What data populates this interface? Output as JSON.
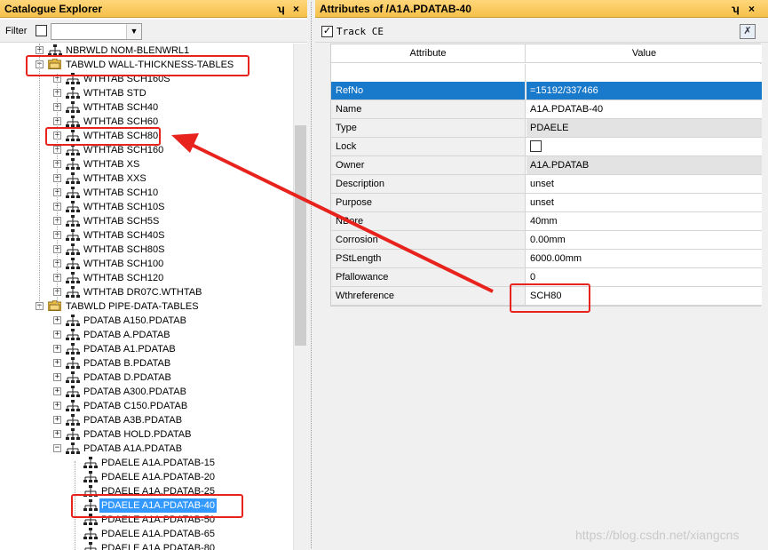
{
  "left_panel": {
    "title": "Catalogue Explorer",
    "pin": "ʮ",
    "close": "×",
    "filter_label": "Filter",
    "filter_value": ""
  },
  "tree": {
    "items": [
      {
        "label": "NBRWLD NOM-BLENWRL1",
        "exp": "+",
        "icon": "tree-icon"
      },
      {
        "label": "TABWLD WALL-THICKNESS-TABLES",
        "exp": "−",
        "icon": "folder-icon"
      },
      {
        "label": "WTHTAB SCH160S",
        "exp": "+",
        "icon": "tree-icon"
      },
      {
        "label": "WTHTAB STD",
        "exp": "+",
        "icon": "tree-icon"
      },
      {
        "label": "WTHTAB SCH40",
        "exp": "+",
        "icon": "tree-icon"
      },
      {
        "label": "WTHTAB SCH60",
        "exp": "+",
        "icon": "tree-icon"
      },
      {
        "label": "WTHTAB SCH80",
        "exp": "+",
        "icon": "tree-icon"
      },
      {
        "label": "WTHTAB SCH160",
        "exp": "+",
        "icon": "tree-icon"
      },
      {
        "label": "WTHTAB XS",
        "exp": "+",
        "icon": "tree-icon"
      },
      {
        "label": "WTHTAB XXS",
        "exp": "+",
        "icon": "tree-icon"
      },
      {
        "label": "WTHTAB SCH10",
        "exp": "+",
        "icon": "tree-icon"
      },
      {
        "label": "WTHTAB SCH10S",
        "exp": "+",
        "icon": "tree-icon"
      },
      {
        "label": "WTHTAB SCH5S",
        "exp": "+",
        "icon": "tree-icon"
      },
      {
        "label": "WTHTAB SCH40S",
        "exp": "+",
        "icon": "tree-icon"
      },
      {
        "label": "WTHTAB SCH80S",
        "exp": "+",
        "icon": "tree-icon"
      },
      {
        "label": "WTHTAB SCH100",
        "exp": "+",
        "icon": "tree-icon"
      },
      {
        "label": "WTHTAB SCH120",
        "exp": "+",
        "icon": "tree-icon"
      },
      {
        "label": "WTHTAB DR07C.WTHTAB",
        "exp": "+",
        "icon": "tree-icon"
      },
      {
        "label": "TABWLD PIPE-DATA-TABLES",
        "exp": "−",
        "icon": "folder-icon"
      },
      {
        "label": "PDATAB A150.PDATAB",
        "exp": "+",
        "icon": "tree-icon"
      },
      {
        "label": "PDATAB A.PDATAB",
        "exp": "+",
        "icon": "tree-icon"
      },
      {
        "label": "PDATAB A1.PDATAB",
        "exp": "+",
        "icon": "tree-icon"
      },
      {
        "label": "PDATAB B.PDATAB",
        "exp": "+",
        "icon": "tree-icon"
      },
      {
        "label": "PDATAB D.PDATAB",
        "exp": "+",
        "icon": "tree-icon"
      },
      {
        "label": "PDATAB A300.PDATAB",
        "exp": "+",
        "icon": "tree-icon"
      },
      {
        "label": "PDATAB C150.PDATAB",
        "exp": "+",
        "icon": "tree-icon"
      },
      {
        "label": "PDATAB A3B.PDATAB",
        "exp": "+",
        "icon": "tree-icon"
      },
      {
        "label": "PDATAB HOLD.PDATAB",
        "exp": "+",
        "icon": "tree-icon"
      },
      {
        "label": "PDATAB A1A.PDATAB",
        "exp": "−",
        "icon": "tree-icon"
      },
      {
        "label": "PDAELE A1A.PDATAB-15",
        "exp": "",
        "icon": "tree-icon"
      },
      {
        "label": "PDAELE A1A.PDATAB-20",
        "exp": "",
        "icon": "tree-icon"
      },
      {
        "label": "PDAELE A1A.PDATAB-25",
        "exp": "",
        "icon": "tree-icon"
      },
      {
        "label": "PDAELE A1A.PDATAB-40",
        "exp": "",
        "icon": "tree-icon",
        "selected": true
      },
      {
        "label": "PDAELE A1A.PDATAB-50",
        "exp": "",
        "icon": "tree-icon"
      },
      {
        "label": "PDAELE A1A.PDATAB-65",
        "exp": "",
        "icon": "tree-icon"
      },
      {
        "label": "PDAELE A1A.PDATAB-80",
        "exp": "",
        "icon": "tree-icon"
      }
    ]
  },
  "right_panel": {
    "title": "Attributes of /A1A.PDATAB-40",
    "pin": "ʮ",
    "close": "×",
    "track_label": "Track CE",
    "track_checked": "✓",
    "clear_icon": "✗"
  },
  "grid": {
    "headers": {
      "attribute": "Attribute",
      "value": "Value"
    },
    "rows": [
      {
        "attribute": "RefNo",
        "value": "=15192/337466",
        "selected": true
      },
      {
        "attribute": "Name",
        "value": "A1A.PDATAB-40"
      },
      {
        "attribute": "Type",
        "value": "PDAELE",
        "readonly": true
      },
      {
        "attribute": "Lock",
        "value": "",
        "checkbox": true
      },
      {
        "attribute": "Owner",
        "value": "A1A.PDATAB",
        "readonly": true
      },
      {
        "attribute": "Description",
        "value": "unset"
      },
      {
        "attribute": "Purpose",
        "value": "unset"
      },
      {
        "attribute": "NBore",
        "value": "40mm"
      },
      {
        "attribute": "Corrosion",
        "value": "0.00mm"
      },
      {
        "attribute": "PStLength",
        "value": "6000.00mm"
      },
      {
        "attribute": "Pfallowance",
        "value": "0"
      },
      {
        "attribute": "Wthreference",
        "value": "SCH80"
      }
    ]
  },
  "watermark": "https://blog.csdn.net/xiangcns",
  "colors": {
    "title_bar": "#f6c04a",
    "selection": "#1979ca",
    "annotation": "#e8231e"
  }
}
